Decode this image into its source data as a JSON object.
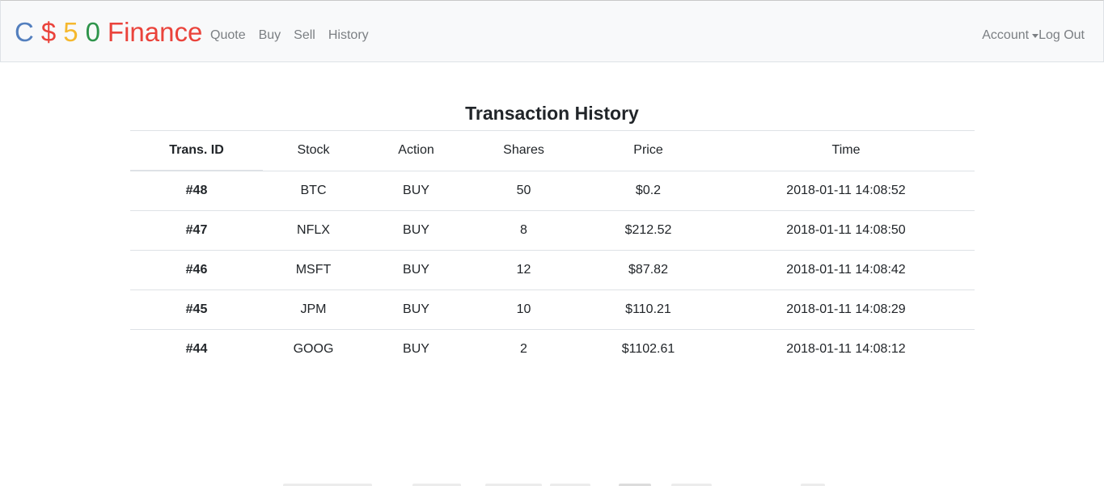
{
  "brand": {
    "letters": [
      {
        "char": "C",
        "color": "#537fbe"
      },
      {
        "char": "$",
        "color": "#ea433b"
      },
      {
        "char": "5",
        "color": "#f5b82e"
      },
      {
        "char": "0",
        "color": "#2e944b"
      }
    ],
    "word": "Finance",
    "word_color": "#ea433b"
  },
  "nav": {
    "items": [
      {
        "label": "Quote"
      },
      {
        "label": "Buy"
      },
      {
        "label": "Sell"
      },
      {
        "label": "History"
      }
    ],
    "account_label": "Account",
    "logout_label": "Log Out"
  },
  "page": {
    "title": "Transaction History"
  },
  "table": {
    "headers": [
      "Trans. ID",
      "Stock",
      "Action",
      "Shares",
      "Price",
      "Time"
    ],
    "rows": [
      [
        "#48",
        "BTC",
        "BUY",
        "50",
        "$0.2",
        "2018-01-11 14:08:52"
      ],
      [
        "#47",
        "NFLX",
        "BUY",
        "8",
        "$212.52",
        "2018-01-11 14:08:50"
      ],
      [
        "#46",
        "MSFT",
        "BUY",
        "12",
        "$87.82",
        "2018-01-11 14:08:42"
      ],
      [
        "#45",
        "JPM",
        "BUY",
        "10",
        "$110.21",
        "2018-01-11 14:08:29"
      ],
      [
        "#44",
        "GOOG",
        "BUY",
        "2",
        "$1102.61",
        "2018-01-11 14:08:12"
      ]
    ]
  }
}
